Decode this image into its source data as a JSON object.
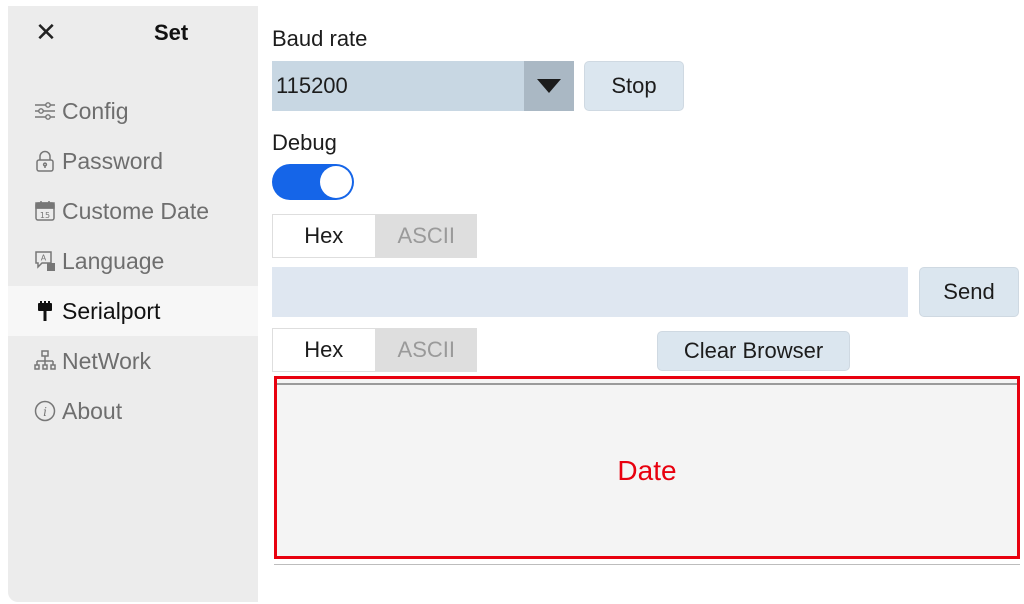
{
  "sidebar": {
    "close_symbol": "✕",
    "title": "Set",
    "items": [
      {
        "label": "Config",
        "icon": "sliders-icon"
      },
      {
        "label": "Password",
        "icon": "lock-icon"
      },
      {
        "label": "Custome Date",
        "icon": "calendar-icon"
      },
      {
        "label": "Language",
        "icon": "language-icon"
      },
      {
        "label": "Serialport",
        "icon": "serial-connector-icon",
        "active": true
      },
      {
        "label": "NetWork",
        "icon": "network-icon"
      },
      {
        "label": "About",
        "icon": "info-icon"
      }
    ]
  },
  "main": {
    "baud_label": "Baud rate",
    "baud_value": "115200",
    "stop_label": "Stop",
    "debug_label": "Debug",
    "debug_enabled": true,
    "send_format": {
      "options": [
        "Hex",
        "ASCII"
      ],
      "selected": "Hex"
    },
    "send_input_value": "",
    "send_label": "Send",
    "receive_format": {
      "options": [
        "Hex",
        "ASCII"
      ],
      "selected": "Hex"
    },
    "clear_label": "Clear Browser",
    "browser_text": "Date"
  },
  "colors": {
    "accent": "#1565e8",
    "highlight_border": "#e8000e",
    "sidebar_bg": "#ececec",
    "button_bg": "#dbe6ef"
  }
}
